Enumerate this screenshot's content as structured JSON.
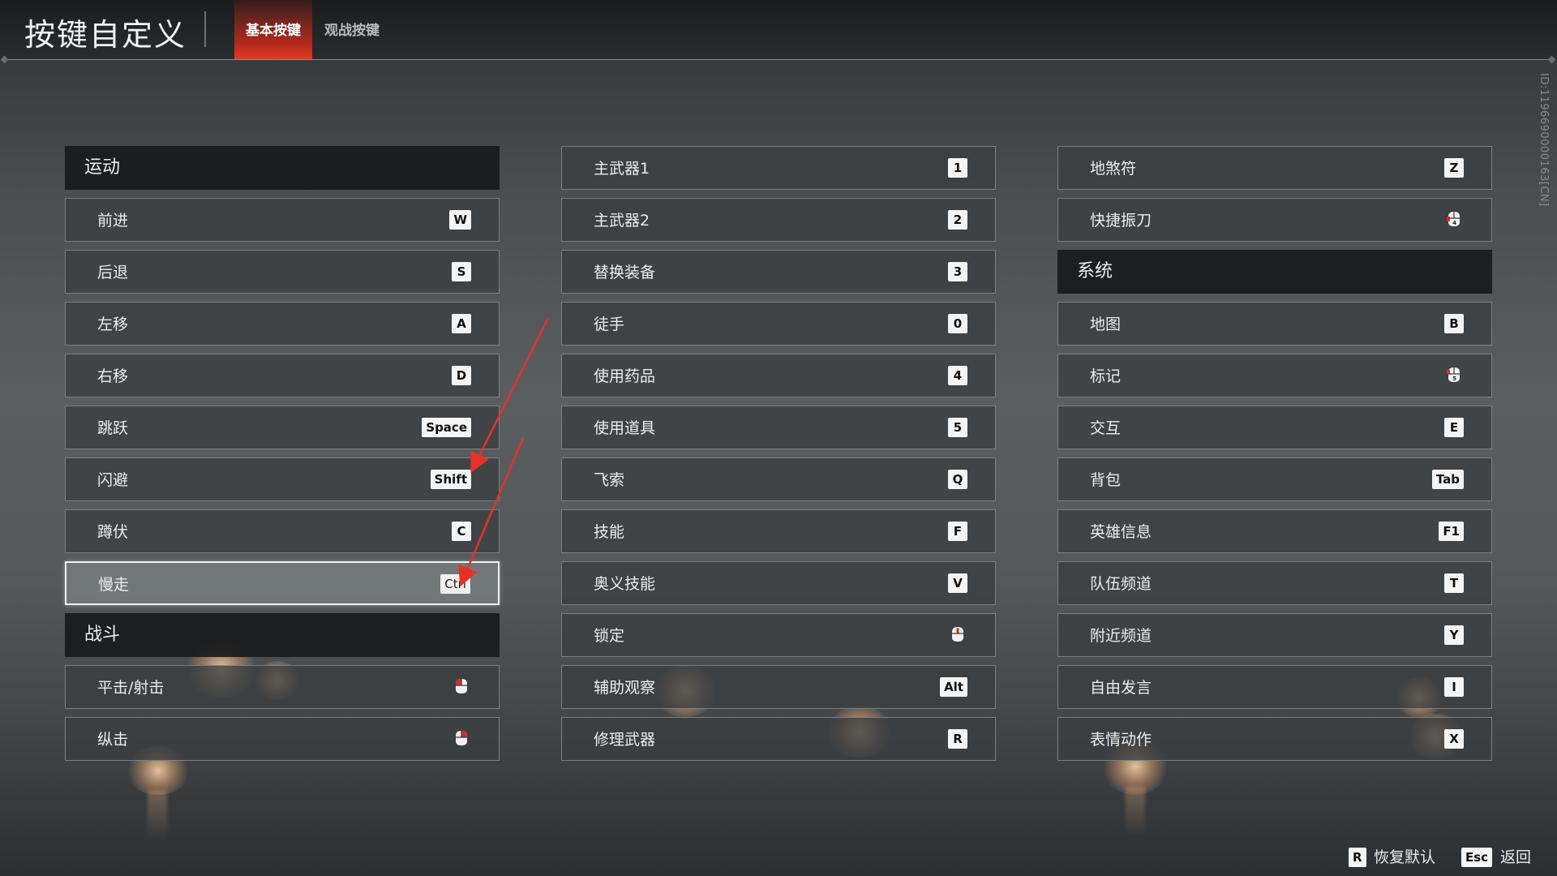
{
  "header": {
    "title": "按键自定义",
    "tabs": [
      {
        "label": "基本按键",
        "active": true
      },
      {
        "label": "观战按键",
        "active": false
      }
    ],
    "version_id": "ID:1196690000163[CN]"
  },
  "columns": [
    {
      "sections": [
        {
          "title": "运动",
          "items": [
            {
              "label": "前进",
              "key": "W"
            },
            {
              "label": "后退",
              "key": "S"
            },
            {
              "label": "左移",
              "key": "A"
            },
            {
              "label": "右移",
              "key": "D"
            },
            {
              "label": "跳跃",
              "key": "Space"
            },
            {
              "label": "闪避",
              "key": "Shift"
            },
            {
              "label": "蹲伏",
              "key": "C"
            },
            {
              "label": "慢走",
              "key": "Ctrl",
              "selected": true
            }
          ]
        },
        {
          "title": "战斗",
          "items": [
            {
              "label": "平击/射击",
              "key_icon": "mouse-left-icon"
            },
            {
              "label": "纵击",
              "key_icon": "mouse-right-icon"
            }
          ]
        }
      ]
    },
    {
      "sections": [
        {
          "items": [
            {
              "label": "主武器1",
              "key": "1"
            },
            {
              "label": "主武器2",
              "key": "2"
            },
            {
              "label": "替换装备",
              "key": "3"
            },
            {
              "label": "徒手",
              "key": "0"
            },
            {
              "label": "使用药品",
              "key": "4"
            },
            {
              "label": "使用道具",
              "key": "5"
            },
            {
              "label": "飞索",
              "key": "Q"
            },
            {
              "label": "技能",
              "key": "F"
            },
            {
              "label": "奥义技能",
              "key": "V"
            },
            {
              "label": "锁定",
              "key_icon": "mouse-middle-icon"
            },
            {
              "label": "辅助观察",
              "key": "Alt"
            },
            {
              "label": "修理武器",
              "key": "R"
            }
          ]
        }
      ]
    },
    {
      "sections": [
        {
          "items": [
            {
              "label": "地煞符",
              "key": "Z"
            },
            {
              "label": "快捷振刀",
              "key_icon": "mouse-side-4-icon"
            }
          ]
        },
        {
          "title": "系统",
          "items": [
            {
              "label": "地图",
              "key": "B"
            },
            {
              "label": "标记",
              "key_icon": "mouse-side-5-icon"
            },
            {
              "label": "交互",
              "key": "E"
            },
            {
              "label": "背包",
              "key": "Tab"
            },
            {
              "label": "英雄信息",
              "key": "F1"
            },
            {
              "label": "队伍频道",
              "key": "T"
            },
            {
              "label": "附近频道",
              "key": "Y"
            },
            {
              "label": "自由发言",
              "key": "I"
            },
            {
              "label": "表情动作",
              "key": "X"
            }
          ]
        }
      ]
    }
  ],
  "footer": {
    "reset": {
      "key": "R",
      "label": "恢复默认"
    },
    "back": {
      "key": "Esc",
      "label": "返回"
    }
  },
  "colors": {
    "accent_tab": "#e6391f",
    "annotation_arrow": "#e53228",
    "key_cap": "#f4f4f4"
  }
}
